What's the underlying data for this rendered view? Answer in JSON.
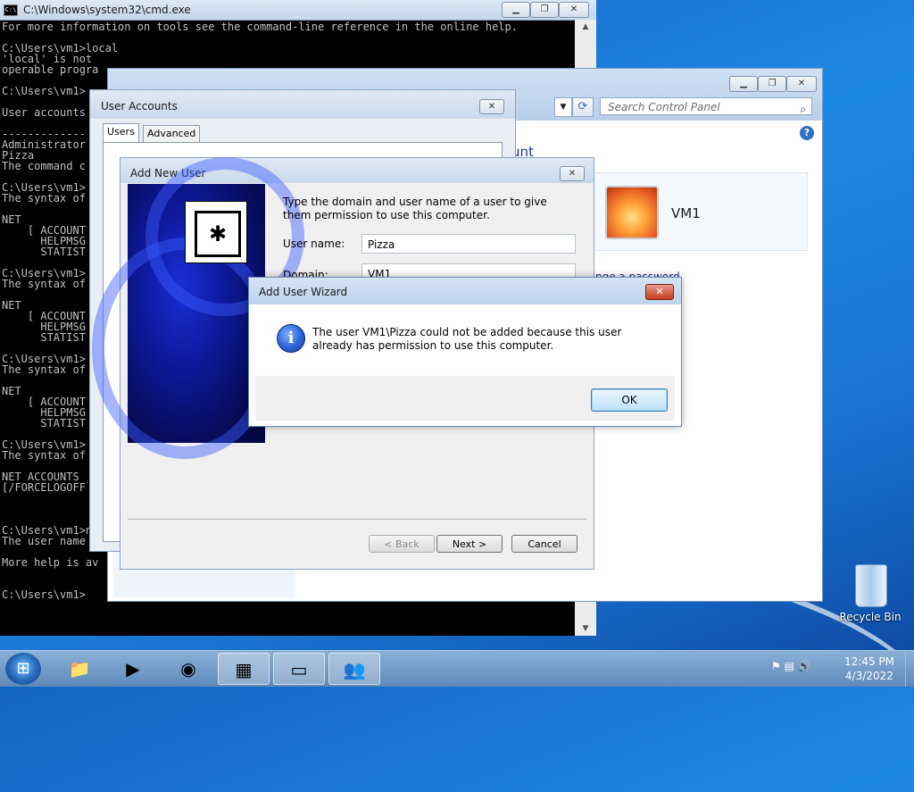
{
  "cmd_window": {
    "title": "C:\\Windows\\system32\\cmd.exe",
    "lines": [
      "For more information on tools see the command-line reference in the online help.",
      "",
      "C:\\Users\\vm1>local",
      "'local' is not",
      "operable progra",
      "",
      "C:\\Users\\vm1>",
      "",
      "User accounts",
      "",
      "-------------",
      "Administrator",
      "Pizza",
      "The command c",
      "",
      "C:\\Users\\vm1>",
      "The syntax of",
      "",
      "NET",
      "    [ ACCOUNT",
      "      HELPMSG",
      "      STATIST",
      "",
      "C:\\Users\\vm1>",
      "The syntax of",
      "",
      "NET",
      "    [ ACCOUNT",
      "      HELPMSG",
      "      STATIST",
      "",
      "C:\\Users\\vm1>",
      "The syntax of",
      "",
      "NET",
      "    [ ACCOUNT",
      "      HELPMSG",
      "      STATIST",
      "",
      "C:\\Users\\vm1>",
      "The syntax of",
      "",
      "NET ACCOUNTS",
      "[/FORCELOGOFF",
      "",
      "",
      "",
      "C:\\Users\\vm1>ne",
      "The user name c",
      "",
      "More help is av",
      "",
      "",
      "C:\\Users\\vm1>"
    ]
  },
  "control_panel": {
    "search_placeholder": "Search Control Panel",
    "heading_fragment": "unt",
    "user_name": "VM1",
    "change_password_fragment": "nge a password"
  },
  "user_accounts": {
    "title": "User Accounts",
    "tabs": [
      "Users",
      "Advanced"
    ]
  },
  "add_new_user": {
    "title": "Add New User",
    "instruction": "Type the domain and user name of a user to give them permission to use this computer.",
    "user_name_label": "User name:",
    "user_name_value": "Pizza",
    "domain_label": "Domain:",
    "domain_value": "VM1",
    "back_label": "< Back",
    "next_label": "Next >",
    "cancel_label": "Cancel"
  },
  "alert": {
    "title": "Add User Wizard",
    "message": "The user VM1\\Pizza could not be added because this user already has permission to use this computer.",
    "ok_label": "OK"
  },
  "desktop": {
    "recycle_bin_label": "Recycle Bin"
  },
  "taskbar": {
    "items": [
      "explorer",
      "media-player",
      "chrome",
      "control-panel",
      "cmd",
      "user-accounts"
    ],
    "time": "12:45 PM",
    "date": "4/3/2022"
  }
}
